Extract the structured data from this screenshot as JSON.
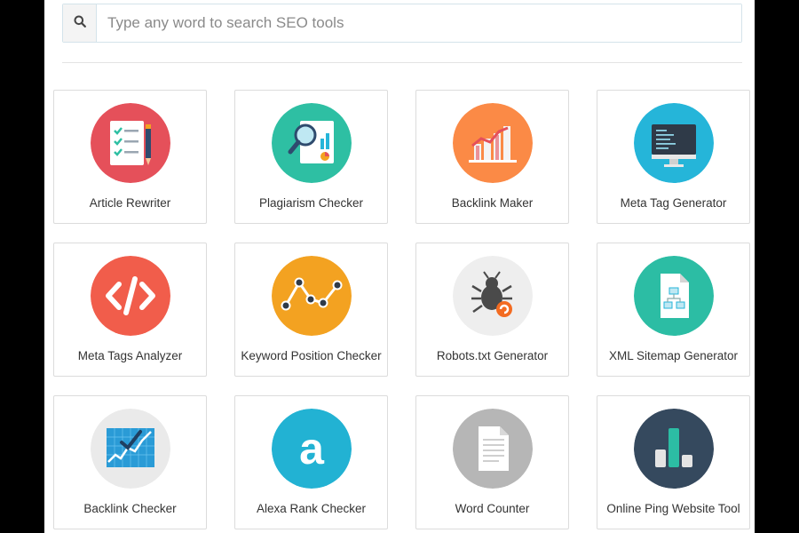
{
  "search": {
    "placeholder": "Type any word to search SEO tools",
    "icon": "search-icon"
  },
  "tools": [
    {
      "label": "Article Rewriter",
      "icon": "article-rewriter-icon",
      "color": "#e5505a"
    },
    {
      "label": "Plagiarism Checker",
      "icon": "plagiarism-checker-icon",
      "color": "#2ebfa3"
    },
    {
      "label": "Backlink Maker",
      "icon": "backlink-maker-icon",
      "color": "#fb8a46"
    },
    {
      "label": "Meta Tag Generator",
      "icon": "meta-tag-generator-icon",
      "color": "#25b5d9"
    },
    {
      "label": "Meta Tags Analyzer",
      "icon": "meta-tags-analyzer-icon",
      "color": "#f15d4b"
    },
    {
      "label": "Keyword Position Checker",
      "icon": "keyword-position-checker-icon",
      "color": "#f3a221"
    },
    {
      "label": "Robots.txt Generator",
      "icon": "robots-txt-generator-icon",
      "color": "#eeeeee"
    },
    {
      "label": "XML Sitemap Generator",
      "icon": "xml-sitemap-generator-icon",
      "color": "#2cbda4"
    },
    {
      "label": "Backlink Checker",
      "icon": "backlink-checker-icon",
      "color": "#eaeaea"
    },
    {
      "label": "Alexa Rank Checker",
      "icon": "alexa-rank-checker-icon",
      "color": "#22b2d3"
    },
    {
      "label": "Word Counter",
      "icon": "word-counter-icon",
      "color": "#b6b6b6"
    },
    {
      "label": "Online Ping Website Tool",
      "icon": "online-ping-website-tool-icon",
      "color": "#35495e"
    }
  ]
}
